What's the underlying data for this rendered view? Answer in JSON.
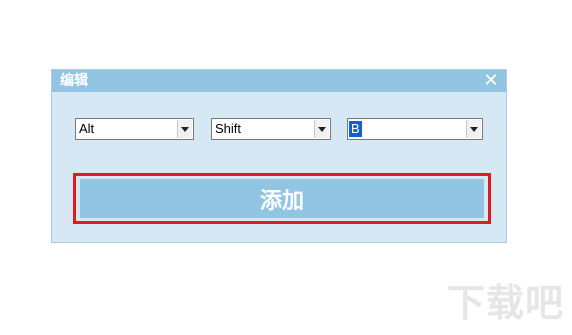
{
  "dialog": {
    "title": "编辑",
    "close_icon": "close-icon",
    "close_glyph": "✕"
  },
  "selectors": [
    {
      "value": "Alt"
    },
    {
      "value": "Shift"
    },
    {
      "value": "B"
    }
  ],
  "add_button": {
    "label": "添加"
  },
  "watermark": {
    "text": "下载吧"
  },
  "colors": {
    "titlebar": "#92c5e3",
    "dialog_bg": "#d6e8f4",
    "button_bg": "#92c5e3",
    "highlight_border": "#e01b1b",
    "selection": "#0a64d6"
  }
}
